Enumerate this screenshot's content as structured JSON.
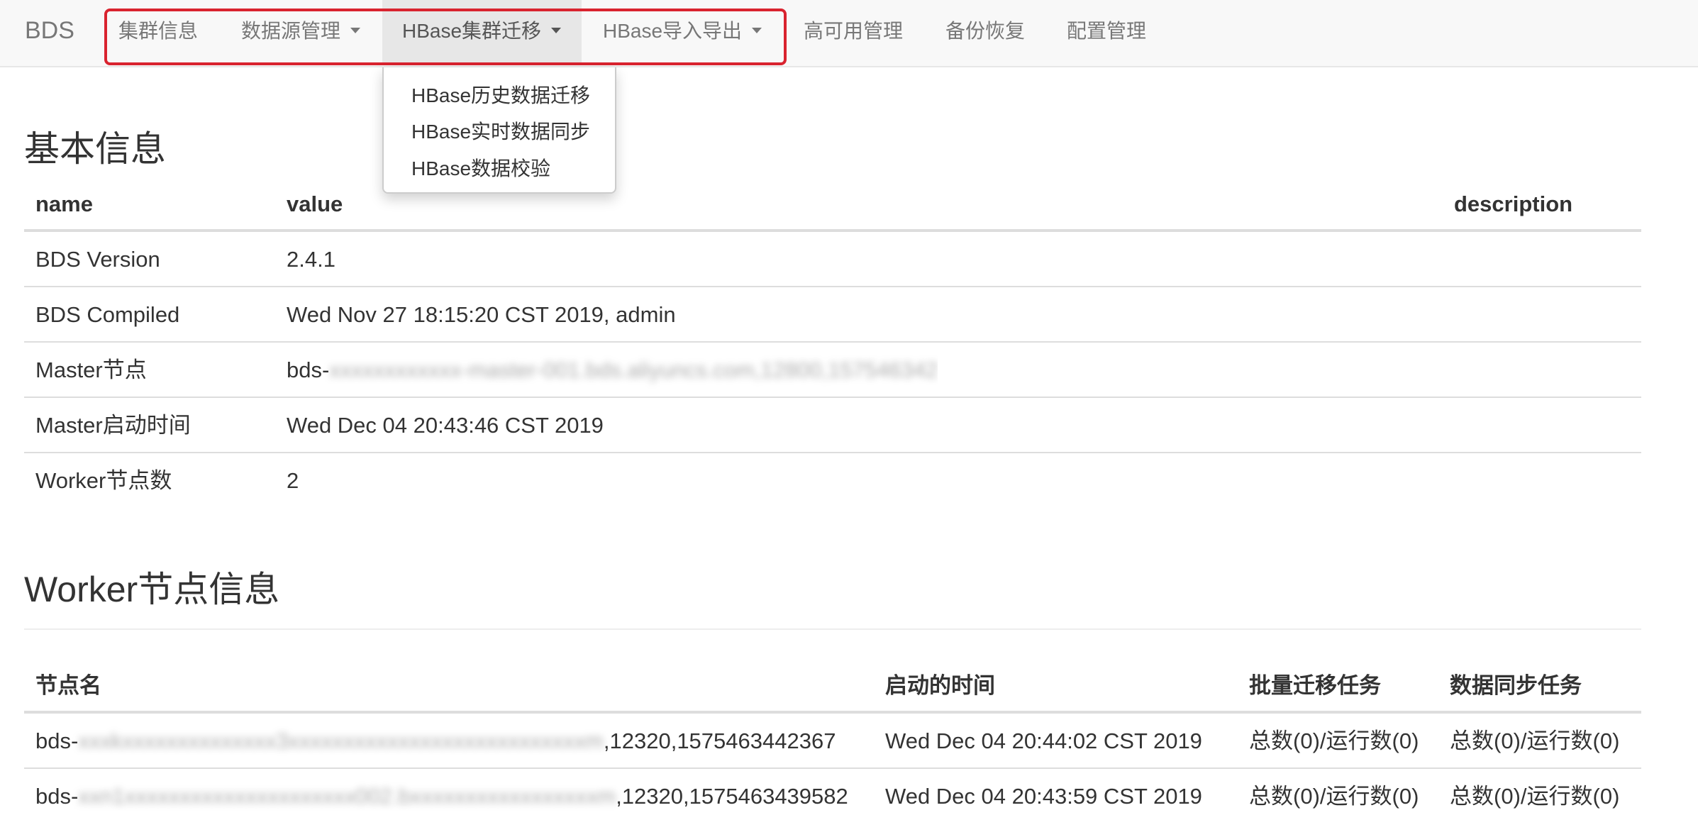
{
  "navbar": {
    "brand": "BDS",
    "items": [
      {
        "label": "集群信息",
        "has_caret": false
      },
      {
        "label": "数据源管理",
        "has_caret": true
      },
      {
        "label": "HBase集群迁移",
        "has_caret": true,
        "active": true
      },
      {
        "label": "HBase导入导出",
        "has_caret": true
      },
      {
        "label": "高可用管理",
        "has_caret": false
      },
      {
        "label": "备份恢复",
        "has_caret": false
      },
      {
        "label": "配置管理",
        "has_caret": false
      }
    ],
    "highlight_color": "#d9232f"
  },
  "dropdown": {
    "items": [
      "HBase历史数据迁移",
      "HBase实时数据同步",
      "HBase数据校验"
    ]
  },
  "basic_info": {
    "title": "基本信息",
    "columns": [
      "name",
      "value",
      "description"
    ],
    "rows": [
      {
        "name": "BDS Version",
        "value": "2.4.1",
        "description": ""
      },
      {
        "name": "BDS Compiled",
        "value": "Wed Nov 27 18:15:20 CST 2019, admin",
        "description": ""
      },
      {
        "name": "Master节点",
        "value_prefix": "bds-",
        "value_blurred": "xxxxxxxxxxxx-master-001.bds.aliyuncs.com,12800,157546342",
        "value_suffix": "",
        "description": ""
      },
      {
        "name": "Master启动时间",
        "value": "Wed Dec 04 20:43:46 CST 2019",
        "description": ""
      },
      {
        "name": "Worker节点数",
        "value": "2",
        "description": ""
      }
    ]
  },
  "worker_info": {
    "title": "Worker节点信息",
    "columns": [
      "节点名",
      "启动的时间",
      "批量迁移任务",
      "数据同步任务"
    ],
    "rows": [
      {
        "node_prefix": "bds-",
        "node_blurred": "xxxkxxxxxxxxxxxxxx3xxxxxxxxxxxxxxxxxxxxxxxxxxxm",
        "node_suffix": ",12320,1575463442367",
        "start_time": "Wed Dec 04 20:44:02 CST 2019",
        "batch_tasks": "总数(0)/运行数(0)",
        "sync_tasks": "总数(0)/运行数(0)"
      },
      {
        "node_prefix": "bds-",
        "node_blurred": "xxn1xxxxxxxxxxxxxxxxxxxxx002.bxxxxxxxxxxxxxxxxxm",
        "node_suffix": ",12320,1575463439582",
        "start_time": "Wed Dec 04 20:43:59 CST 2019",
        "batch_tasks": "总数(0)/运行数(0)",
        "sync_tasks": "总数(0)/运行数(0)"
      }
    ]
  }
}
